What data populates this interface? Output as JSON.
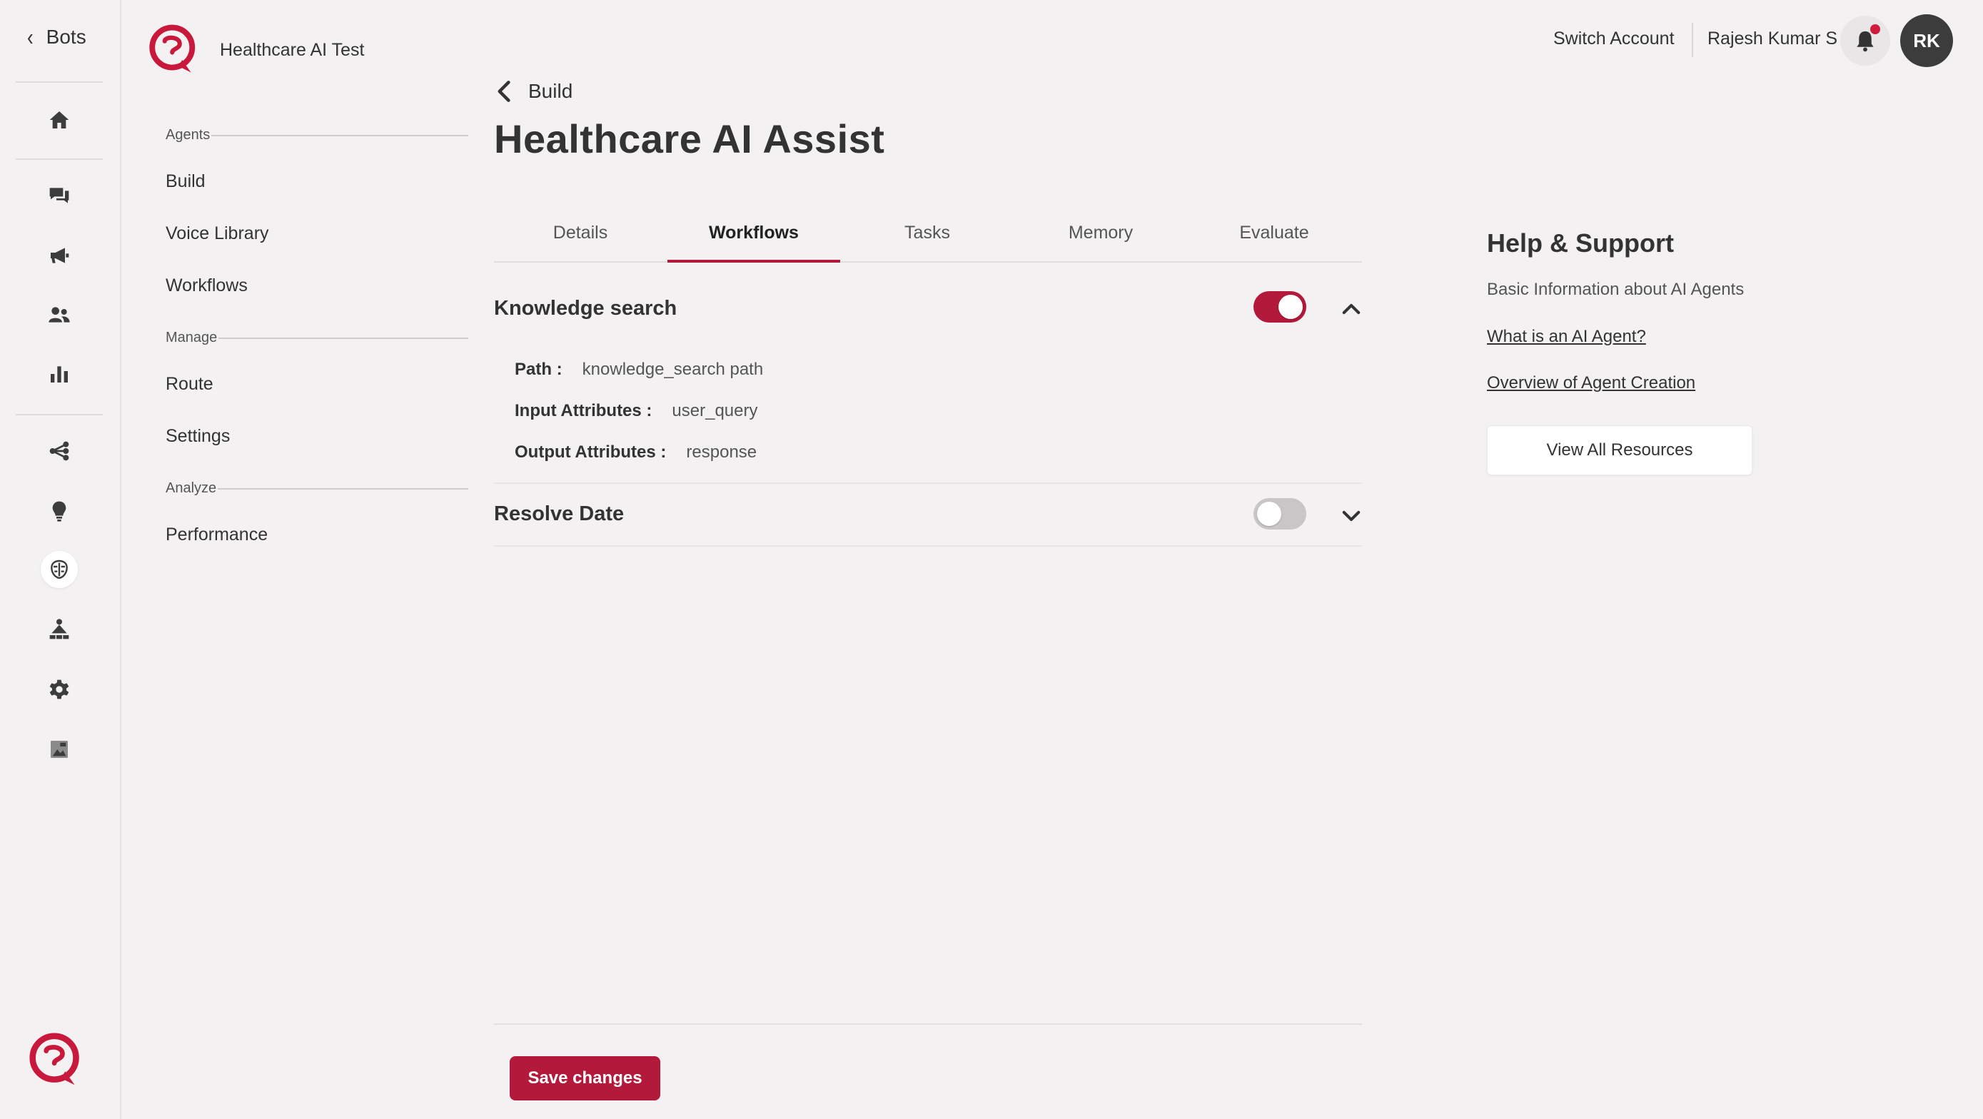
{
  "colors": {
    "accent": "#b3193a",
    "background": "#f3f1f2",
    "dark_icon": "#3c3c3c"
  },
  "rail": {
    "back_label": "Bots",
    "icons": [
      "home-icon",
      "chat-icon",
      "megaphone-icon",
      "users-icon",
      "bar-chart-icon",
      "workflow-icon",
      "bulb-icon",
      "brain-icon",
      "hierarchy-icon",
      "gear-icon",
      "image-icon"
    ],
    "active_icon": "brain-icon"
  },
  "brand": {
    "name": "Healthcare AI Test"
  },
  "nav": {
    "sections": [
      {
        "label": "Agents",
        "items": [
          "Build",
          "Voice Library",
          "Workflows"
        ]
      },
      {
        "label": "Manage",
        "items": [
          "Route",
          "Settings"
        ]
      },
      {
        "label": "Analyze",
        "items": [
          "Performance"
        ]
      }
    ]
  },
  "header": {
    "breadcrumb": "Build",
    "title": "Healthcare AI Assist",
    "switch_account": "Switch Account",
    "user_name": "Rajesh Kumar S",
    "avatar_initials": "RK",
    "has_notification": true
  },
  "tabs": [
    {
      "label": "Details",
      "active": false
    },
    {
      "label": "Workflows",
      "active": true
    },
    {
      "label": "Tasks",
      "active": false
    },
    {
      "label": "Memory",
      "active": false
    },
    {
      "label": "Evaluate",
      "active": false
    }
  ],
  "workflows": [
    {
      "name": "Knowledge search",
      "enabled": true,
      "expanded": true,
      "attributes": [
        {
          "key": "Path :",
          "value": "knowledge_search path"
        },
        {
          "key": "Input Attributes :",
          "value": "user_query"
        },
        {
          "key": "Output Attributes :",
          "value": "response"
        }
      ]
    },
    {
      "name": "Resolve Date",
      "enabled": false,
      "expanded": false,
      "attributes": []
    }
  ],
  "save_label": "Save changes",
  "help": {
    "title": "Help & Support",
    "subtitle": "Basic Information about AI Agents",
    "links": [
      "What is an AI Agent?",
      "Overview of Agent Creation"
    ],
    "button": "View All Resources"
  }
}
